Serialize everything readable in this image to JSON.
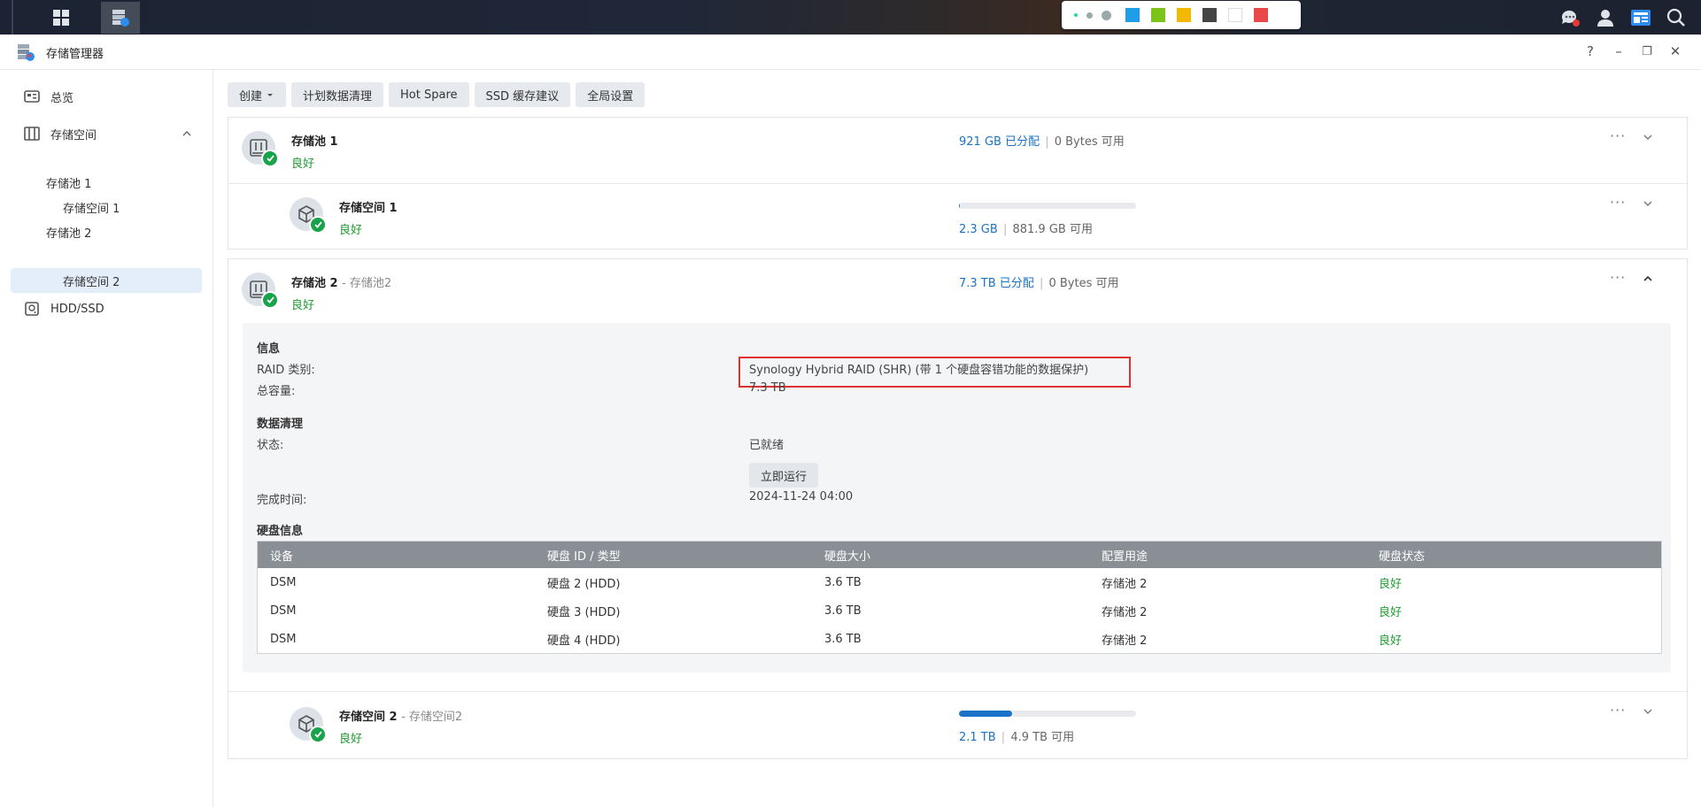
{
  "app": {
    "title": "存储管理器"
  },
  "window_controls": {
    "help": "?",
    "minimize": "–",
    "restore": "❐",
    "close": "✕"
  },
  "palette": {
    "colors": [
      "#1e9ee8",
      "#7cc41a",
      "#f5b800",
      "#444444",
      "#ffffff",
      "#e84848"
    ]
  },
  "sidebar": {
    "overview": "总览",
    "storage": "存储空间",
    "pool1": "存储池 1",
    "pool1_vol1": "存储空间 1",
    "pool2": "存储池 2",
    "pool2_vol2": "存储空间 2",
    "hdd": "HDD/SSD"
  },
  "toolbar": {
    "create": "创建",
    "scrub_schedule": "计划数据清理",
    "hot_spare": "Hot Spare",
    "ssd_cache": "SSD 缓存建议",
    "global_settings": "全局设置"
  },
  "pool1": {
    "name": "存储池 1",
    "status": "良好",
    "allocated": "921 GB 已分配",
    "available": "0 Bytes 可用"
  },
  "vol1": {
    "name": "存储空间 1",
    "status": "良好",
    "used": "2.3 GB",
    "available": "881.9 GB 可用",
    "used_fraction": 0.003
  },
  "pool2": {
    "name": "存储池 2",
    "subname": "- 存储池2",
    "status": "良好",
    "allocated": "7.3 TB 已分配",
    "available": "0 Bytes 可用",
    "info": {
      "title": "信息",
      "raid_label": "RAID 类别:",
      "raid_value": "Synology Hybrid RAID (SHR) (带 1 个硬盘容错功能的数据保护)",
      "capacity_label": "总容量:",
      "capacity_value": "7.3 TB"
    },
    "scrub": {
      "title": "数据清理",
      "status_label": "状态:",
      "status_value": "已就绪",
      "run_button": "立即运行",
      "time_label": "完成时间:",
      "time_value": "2024-11-24 04:00"
    },
    "disks": {
      "title": "硬盘信息",
      "headers": [
        "设备",
        "硬盘 ID / 类型",
        "硬盘大小",
        "配置用途",
        "硬盘状态"
      ],
      "rows": [
        [
          "DSM",
          "硬盘 2 (HDD)",
          "3.6 TB",
          "存储池 2",
          "良好"
        ],
        [
          "DSM",
          "硬盘 3 (HDD)",
          "3.6 TB",
          "存储池 2",
          "良好"
        ],
        [
          "DSM",
          "硬盘 4 (HDD)",
          "3.6 TB",
          "存储池 2",
          "良好"
        ]
      ]
    }
  },
  "vol2": {
    "name": "存储空间 2",
    "subname": "- 存储空间2",
    "status": "良好",
    "used": "2.1 TB",
    "available": "4.9 TB 可用",
    "used_fraction": 0.3
  },
  "more_glyph": "···"
}
